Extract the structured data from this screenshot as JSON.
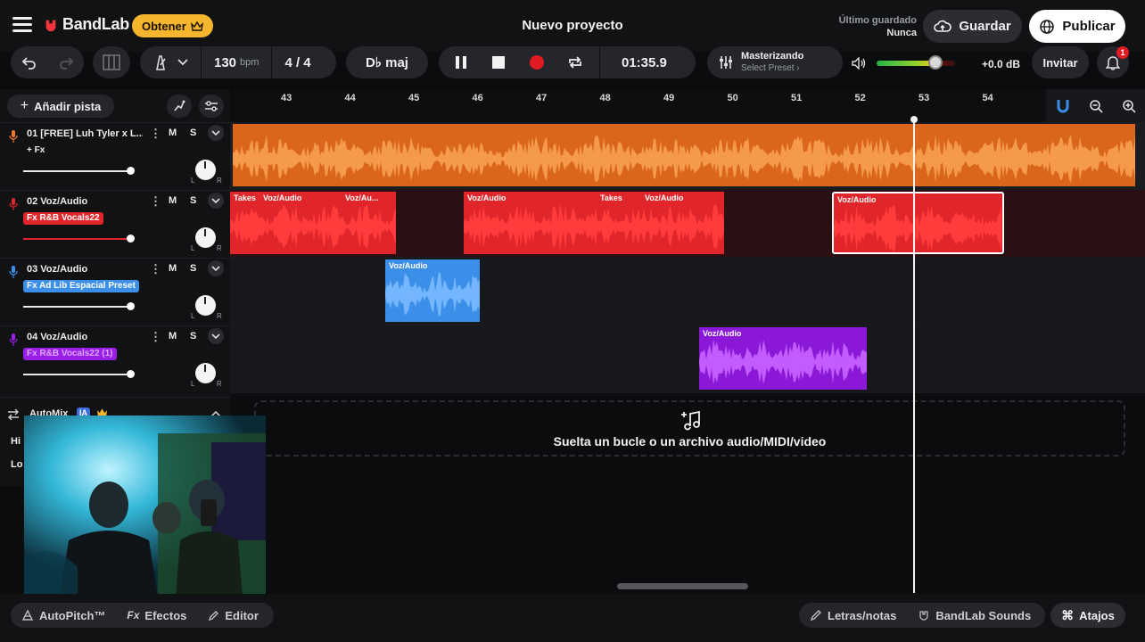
{
  "brand": {
    "name": "BandLab",
    "upgrade_label": "Obtener"
  },
  "project": {
    "title": "Nuevo proyecto"
  },
  "save_status": {
    "label": "Último guardado",
    "value": "Nunca"
  },
  "actions": {
    "save_label": "Guardar",
    "publish_label": "Publicar",
    "invite_label": "Invitar",
    "notification_count": "1"
  },
  "transport": {
    "tempo": "130",
    "tempo_unit": "bpm",
    "time_signature": "4 / 4",
    "key": "D♭ maj",
    "time": "01:35.9",
    "mastering_title": "Masterizando",
    "mastering_preset": "Select Preset ›",
    "volume_db": "+0.0 dB",
    "volume_level": 0.75
  },
  "tracks_panel": {
    "add_track_label": "Añadir pista"
  },
  "tracks": [
    {
      "name": "01  [FREE] Luh Tyler x L...",
      "fx": "+ Fx",
      "color": "#f07a1e",
      "mute": "M",
      "solo": "S",
      "volume": 0.75
    },
    {
      "name": "02  Voz/Audio",
      "fx": "Fx R&B Vocals22",
      "color": "#e0262a",
      "mute": "M",
      "solo": "S",
      "volume": 0.75
    },
    {
      "name": "03  Voz/Audio",
      "fx": "Fx Ad Lib Espacial Preset",
      "color": "#3b8fe8",
      "mute": "M",
      "solo": "S",
      "volume": 0.75
    },
    {
      "name": "04  Voz/Audio",
      "fx": "Fx R&B Vocals22 (1)",
      "color": "#9a1ee8",
      "mute": "M",
      "solo": "S",
      "volume": 0.75
    }
  ],
  "automix": {
    "label": "AutoMix",
    "badge": "IA",
    "row1": "Hi",
    "row2": "Lo"
  },
  "ruler": {
    "bars": [
      "43",
      "44",
      "45",
      "46",
      "47",
      "48",
      "49",
      "50",
      "51",
      "52",
      "53",
      "54"
    ]
  },
  "clips": {
    "takes": "Takes",
    "voz": "Voz/Audio",
    "voz_short": "Voz/Au..."
  },
  "drop_zone": {
    "text": "Suelta un bucle o un archivo audio/MIDI/video"
  },
  "bottom": {
    "autopitch": "AutoPitch™",
    "effects": "Efectos",
    "editor": "Editor",
    "lyrics": "Letras/notas",
    "sounds": "BandLab Sounds",
    "shortcuts": "Atajos"
  },
  "colors": {
    "orange": "#f07a1e",
    "red": "#e0262a",
    "blue": "#3b8fe8",
    "purple": "#9a1ee8",
    "accent_yellow": "#f5b52d"
  }
}
